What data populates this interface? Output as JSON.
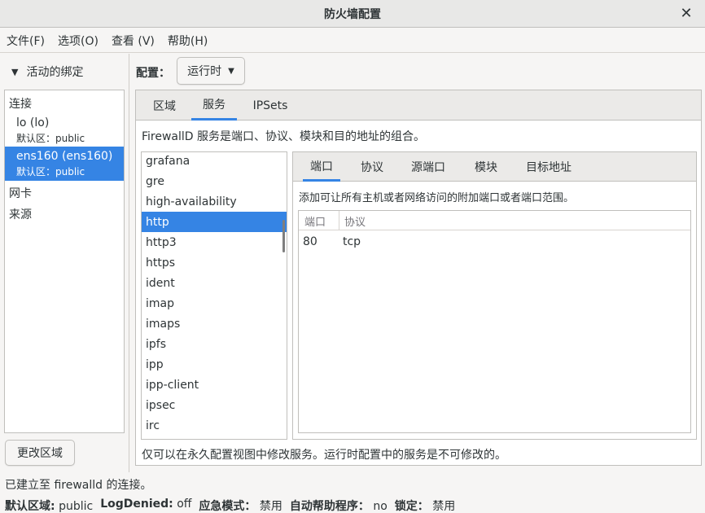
{
  "window": {
    "title": "防火墙配置",
    "close_glyph": "✕"
  },
  "menu": [
    "文件(F)",
    "选项(O)",
    "查看 (V)",
    "帮助(H)"
  ],
  "left": {
    "heading": "活动的绑定",
    "sections": {
      "connections": "连接",
      "interfaces": "网卡",
      "sources": "来源"
    },
    "bindings": [
      {
        "name": "lo (lo)",
        "zone": "默认区：public",
        "selected": false
      },
      {
        "name": "ens160 (ens160)",
        "zone": "默认区：public",
        "selected": true
      }
    ],
    "change_zone_button": "更改区域"
  },
  "config": {
    "label": "配置：",
    "value": "运行时"
  },
  "tabs": [
    {
      "label": "区域",
      "active": false
    },
    {
      "label": "服务",
      "active": true
    },
    {
      "label": "IPSets",
      "active": false
    }
  ],
  "service_description": "FirewallD 服务是端口、协议、模块和目的地址的组合。",
  "services": [
    "grafana",
    "gre",
    "high-availability",
    "http",
    "http3",
    "https",
    "ident",
    "imap",
    "imaps",
    "ipfs",
    "ipp",
    "ipp-client",
    "ipsec",
    "irc"
  ],
  "selected_service": "http",
  "subtabs": [
    {
      "label": "端口",
      "active": true
    },
    {
      "label": "协议",
      "active": false
    },
    {
      "label": "源端口",
      "active": false
    },
    {
      "label": "模块",
      "active": false
    },
    {
      "label": "目标地址",
      "active": false
    }
  ],
  "ports_description": "添加可让所有主机或者网络访问的附加端口或者端口范围。",
  "ports_table": {
    "columns": [
      "端口",
      "协议"
    ],
    "rows": [
      {
        "port": "80",
        "protocol": "tcp"
      }
    ]
  },
  "bottom_note": "仅可以在永久配置视图中修改服务。运行时配置中的服务是不可修改的。",
  "status": {
    "connection": "已建立至 firewalld 的连接。",
    "items": [
      {
        "label": "默认区域:",
        "value": "public"
      },
      {
        "label": "LogDenied:",
        "value": "off"
      },
      {
        "label": "应急模式：",
        "value": "禁用"
      },
      {
        "label": "自动帮助程序：",
        "value": "no"
      },
      {
        "label": "锁定：",
        "value": "禁用"
      }
    ]
  },
  "colors": {
    "accent": "#3584e4",
    "background": "#f6f5f4"
  }
}
